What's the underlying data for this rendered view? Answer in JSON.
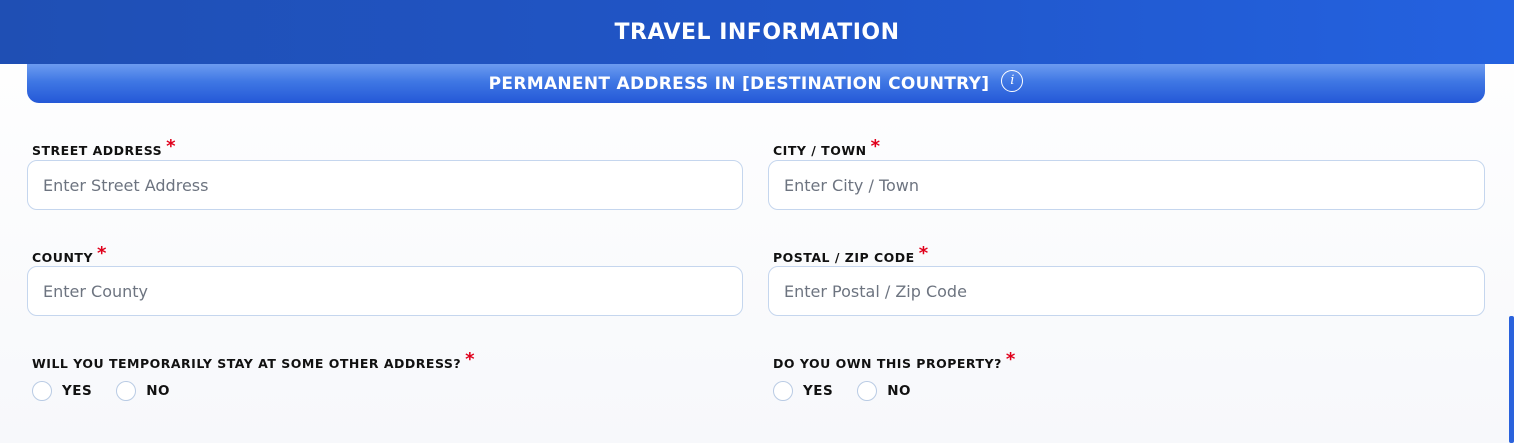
{
  "header": {
    "title": "TRAVEL INFORMATION"
  },
  "section": {
    "title": "PERMANENT ADDRESS IN [DESTINATION COUNTRY]",
    "info_glyph": "i"
  },
  "required_mark": "*",
  "fields": {
    "street": {
      "label": "STREET ADDRESS",
      "placeholder": "Enter Street Address",
      "value": ""
    },
    "city": {
      "label": "CITY / TOWN",
      "placeholder": "Enter City / Town",
      "value": ""
    },
    "county": {
      "label": "COUNTY",
      "placeholder": "Enter County",
      "value": ""
    },
    "postal": {
      "label": "POSTAL / ZIP CODE",
      "placeholder": "Enter Postal / Zip Code",
      "value": ""
    }
  },
  "questions": {
    "temp_stay": {
      "label": "WILL YOU TEMPORARILY STAY AT SOME OTHER ADDRESS?",
      "yes": "YES",
      "no": "NO"
    },
    "own_property": {
      "label": "DO YOU OWN THIS PROPERTY?",
      "yes": "YES",
      "no": "NO"
    }
  },
  "colors": {
    "header_bg": "#2056c9",
    "section_bg": "#3f77e4",
    "required": "#e0001b",
    "input_border": "#c5d6ee",
    "scrollbar": "#2a62dc"
  }
}
